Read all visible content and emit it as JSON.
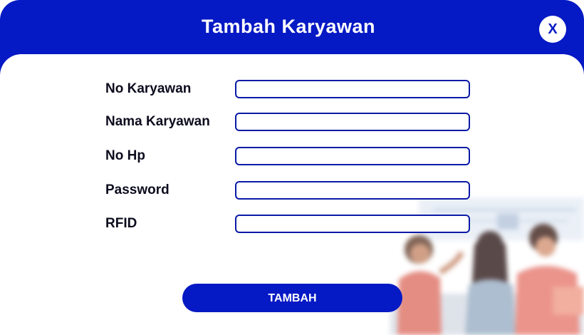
{
  "dialog": {
    "title": "Tambah Karyawan",
    "close_label": "X"
  },
  "form": {
    "fields": [
      {
        "label": "No Karyawan",
        "value": "",
        "placeholder": ""
      },
      {
        "label": "Nama Karyawan",
        "value": "",
        "placeholder": ""
      },
      {
        "label": "No Hp",
        "value": "",
        "placeholder": ""
      },
      {
        "label": "Password",
        "value": "",
        "placeholder": ""
      },
      {
        "label": "RFID",
        "value": "",
        "placeholder": ""
      }
    ],
    "submit_label": "TAMBAH"
  },
  "colors": {
    "primary": "#0519c4",
    "field_border": "#0a1aa6",
    "label_text": "#0c0c1e"
  },
  "illustration": {
    "icon": "office-workers-illustration"
  }
}
